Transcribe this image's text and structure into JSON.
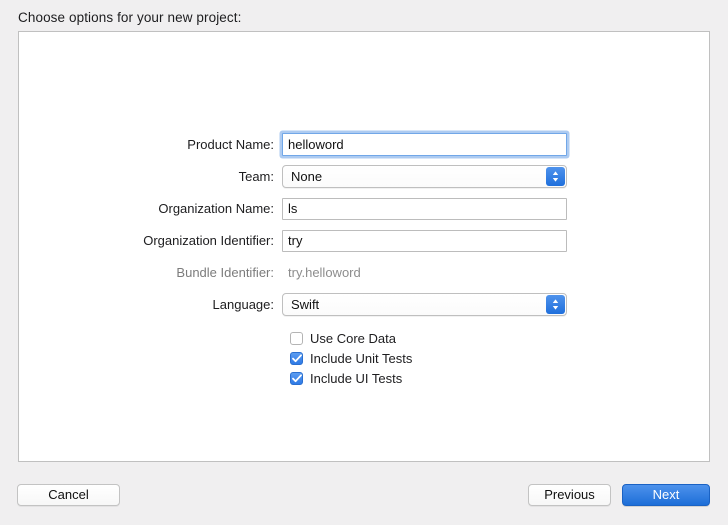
{
  "dialog": {
    "prompt": "Choose options for your new project:"
  },
  "form": {
    "fields": [
      {
        "label": "Product Name:",
        "type": "text",
        "value": "helloword",
        "placeholder": "",
        "focused": true,
        "name": "product-name"
      },
      {
        "label": "Team:",
        "type": "popup",
        "value": "None",
        "name": "team"
      },
      {
        "label": "Organization Name:",
        "type": "text",
        "value": "ls",
        "placeholder": "",
        "focused": false,
        "name": "organization-name"
      },
      {
        "label": "Organization Identifier:",
        "type": "text",
        "value": "try",
        "placeholder": "",
        "focused": false,
        "name": "organization-identifier"
      },
      {
        "label": "Bundle Identifier:",
        "type": "static",
        "value": "try.helloword",
        "name": "bundle-identifier"
      },
      {
        "label": "Language:",
        "type": "popup",
        "value": "Swift",
        "name": "language"
      }
    ],
    "checkboxes": [
      {
        "label": "Use Core Data",
        "checked": false,
        "name": "use-core-data"
      },
      {
        "label": "Include Unit Tests",
        "checked": true,
        "name": "include-unit-tests"
      },
      {
        "label": "Include UI Tests",
        "checked": true,
        "name": "include-ui-tests"
      }
    ]
  },
  "footer": {
    "cancel_label": "Cancel",
    "previous_label": "Previous",
    "next_label": "Next"
  },
  "icons": {
    "popup_stepper": "chevron-up-down-icon",
    "checkmark": "checkmark-icon"
  },
  "colors": {
    "accent_blue": "#2f7ae6",
    "primary_button": "#1d6ed8",
    "focus_ring": "#6aa0e6",
    "window_background": "#f0eff0",
    "panel_background": "#ffffff",
    "disabled_text": "#8d8d8d"
  }
}
